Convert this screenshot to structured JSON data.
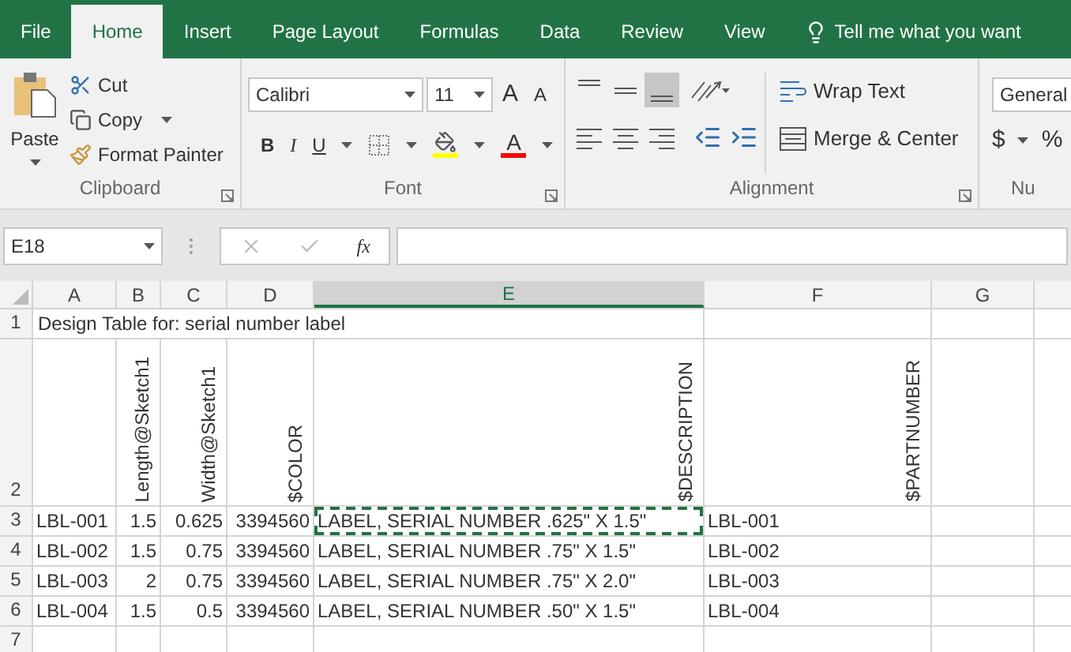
{
  "tabs": [
    {
      "label": "File",
      "selected": false
    },
    {
      "label": "Home",
      "selected": true
    },
    {
      "label": "Insert",
      "selected": false
    },
    {
      "label": "Page Layout",
      "selected": false
    },
    {
      "label": "Formulas",
      "selected": false
    },
    {
      "label": "Data",
      "selected": false
    },
    {
      "label": "Review",
      "selected": false
    },
    {
      "label": "View",
      "selected": false
    }
  ],
  "tell_me": "Tell me what you want",
  "ribbon": {
    "clipboard": {
      "paste": "Paste",
      "cut": "Cut",
      "copy": "Copy",
      "format_painter": "Format Painter",
      "label": "Clipboard"
    },
    "font": {
      "name": "Calibri",
      "size": "11",
      "grow": "A",
      "shrink": "A",
      "bold": "B",
      "italic": "I",
      "underline": "U",
      "color_letter": "A",
      "label": "Font"
    },
    "alignment": {
      "wrap": "Wrap Text",
      "merge": "Merge & Center",
      "label": "Alignment",
      "bottom_align_selected": true
    },
    "number": {
      "format": "General",
      "currency": "$",
      "percent": "%",
      "label": "Nu"
    }
  },
  "name_box": "E18",
  "fx": "fx",
  "columns": [
    {
      "label": "A",
      "selected": false
    },
    {
      "label": "B",
      "selected": false
    },
    {
      "label": "C",
      "selected": false
    },
    {
      "label": "D",
      "selected": false
    },
    {
      "label": "E",
      "selected": true
    },
    {
      "label": "F",
      "selected": false
    },
    {
      "label": "G",
      "selected": false
    }
  ],
  "rows": [
    {
      "number": "1",
      "kind": "title",
      "cells": [
        {
          "text": "Design Table for: serial number label",
          "copied": false
        }
      ]
    },
    {
      "number": "2",
      "kind": "header",
      "cells": [
        null,
        {
          "text": "Length@Sketch1",
          "copied": false
        },
        {
          "text": "Width@Sketch1",
          "copied": false
        },
        {
          "text": "$COLOR",
          "copied": false
        },
        {
          "text": "$DESCRIPTION",
          "copied": false
        },
        {
          "text": "$PARTNUMBER",
          "copied": false
        }
      ]
    },
    {
      "number": "3",
      "kind": "data",
      "cells": [
        {
          "text": "LBL-001",
          "copied": false
        },
        {
          "text": "1.5",
          "copied": false
        },
        {
          "text": "0.625",
          "copied": false
        },
        {
          "text": "3394560",
          "copied": false
        },
        {
          "text": "LABEL, SERIAL NUMBER .625\" X 1.5\"",
          "copied": true
        },
        {
          "text": "LBL-001",
          "copied": false
        }
      ]
    },
    {
      "number": "4",
      "kind": "data",
      "cells": [
        {
          "text": "LBL-002",
          "copied": false
        },
        {
          "text": "1.5",
          "copied": false
        },
        {
          "text": "0.75",
          "copied": false
        },
        {
          "text": "3394560",
          "copied": false
        },
        {
          "text": "LABEL, SERIAL NUMBER .75\" X 1.5\"",
          "copied": false
        },
        {
          "text": "LBL-002",
          "copied": false
        }
      ]
    },
    {
      "number": "5",
      "kind": "data",
      "cells": [
        {
          "text": "LBL-003",
          "copied": false
        },
        {
          "text": "2",
          "copied": false
        },
        {
          "text": "0.75",
          "copied": false
        },
        {
          "text": "3394560",
          "copied": false
        },
        {
          "text": "LABEL, SERIAL NUMBER .75\" X 2.0\"",
          "copied": false
        },
        {
          "text": "LBL-003",
          "copied": false
        }
      ]
    },
    {
      "number": "6",
      "kind": "data",
      "cells": [
        {
          "text": "LBL-004",
          "copied": false
        },
        {
          "text": "1.5",
          "copied": false
        },
        {
          "text": "0.5",
          "copied": false
        },
        {
          "text": "3394560",
          "copied": false
        },
        {
          "text": "LABEL, SERIAL NUMBER .50\" X 1.5\"",
          "copied": false
        },
        {
          "text": "LBL-004",
          "copied": false
        }
      ]
    },
    {
      "number": "7",
      "kind": "empty",
      "cells": []
    }
  ]
}
